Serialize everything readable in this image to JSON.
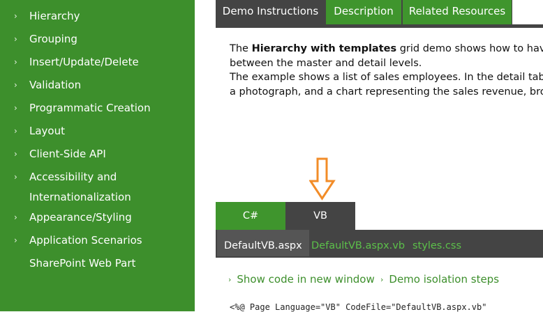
{
  "sidebar": {
    "items": [
      {
        "label": "Hierarchy",
        "chevron": true
      },
      {
        "label": "Grouping",
        "chevron": true
      },
      {
        "label": "Insert/Update/Delete",
        "chevron": true
      },
      {
        "label": "Validation",
        "chevron": true
      },
      {
        "label": "Programmatic Creation",
        "chevron": true
      },
      {
        "label": "Layout",
        "chevron": true
      },
      {
        "label": "Client-Side API",
        "chevron": true
      },
      {
        "label": "Accessibility and",
        "label2": "Internationalization",
        "chevron": true
      },
      {
        "label": "Appearance/Styling",
        "chevron": true
      },
      {
        "label": "Application Scenarios",
        "chevron": true
      },
      {
        "label": "SharePoint Web Part",
        "chevron": false
      }
    ],
    "chevron_glyph": "›"
  },
  "top_tabs": [
    {
      "label": "Demo Instructions",
      "active": true
    },
    {
      "label": "Description",
      "active": false
    },
    {
      "label": "Related Resources",
      "active": false
    }
  ],
  "description": {
    "line1_prefix": "The ",
    "line1_bold": "Hierarchy with templates",
    "line1_suffix": " grid demo shows how to have a",
    "line2": "between the master and detail levels.",
    "line3": "The example shows a list of sales employees. In the detail table fo",
    "line4": "a photograph, and a chart representing the sales revenue, broken"
  },
  "lang_tabs": {
    "csharp": "C#",
    "vb": "VB"
  },
  "file_tabs": {
    "active": "DefaultVB.aspx",
    "links": [
      "DefaultVB.aspx.vb",
      "styles.css"
    ]
  },
  "code_links": {
    "show_code": "Show code in new window",
    "isolation": "Demo isolation steps"
  },
  "code_line": "<%@ Page Language=\"VB\" CodeFile=\"DefaultVB.aspx.vb\"",
  "icons": {
    "arrow": "down-arrow-icon",
    "chevron": "chevron-right-icon"
  },
  "colors": {
    "sidebar": "#3d8f2c",
    "dark": "#444444",
    "tab_green": "#3f952d",
    "arrow": "#f28c28",
    "link_green": "#5cc04a"
  }
}
